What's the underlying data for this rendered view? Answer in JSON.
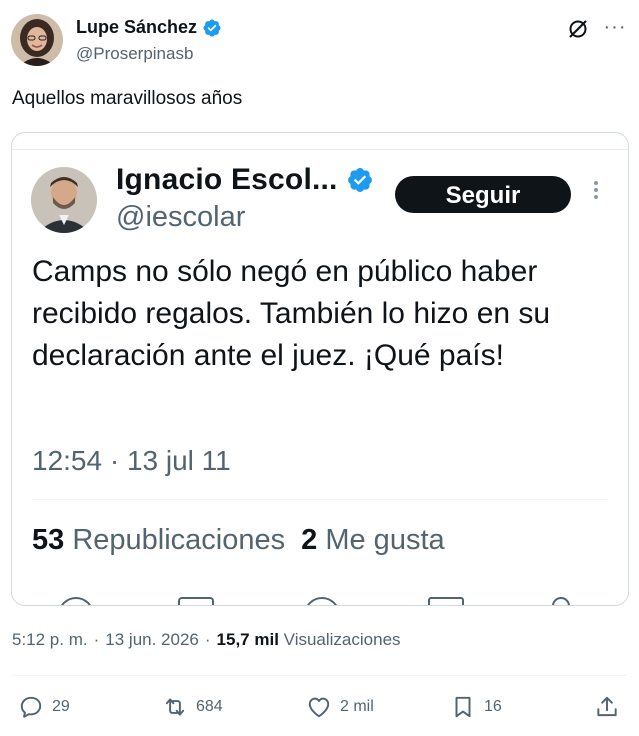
{
  "author": {
    "name": "Lupe Sánchez",
    "handle": "@Proserpinasb"
  },
  "tweet": {
    "text": "Aquellos maravillosos años"
  },
  "quoted": {
    "name": "Ignacio Escol...",
    "handle": "@iescolar",
    "follow_label": "Seguir",
    "text": "Camps no sólo negó en público haber recibido regalos. También lo hizo en su declaración ante el juez. ¡Qué país!",
    "time": "12:54 · 13 jul 11",
    "reposts_count": "53",
    "reposts_label": "Republicaciones",
    "likes_count": "2",
    "likes_label": "Me gusta"
  },
  "meta": {
    "time": "5:12 p. m.",
    "sep1": "·",
    "date": "13 jun. 2026",
    "sep2": "·",
    "views_count": "15,7 mil",
    "views_label": "Visualizaciones"
  },
  "actions": {
    "replies": "29",
    "reposts": "684",
    "likes": "2 mil",
    "bookmarks": "16"
  },
  "colors": {
    "verified": "#1d9bf0",
    "text": "#0f1419",
    "secondary": "#536471",
    "border": "#cfd9de"
  }
}
